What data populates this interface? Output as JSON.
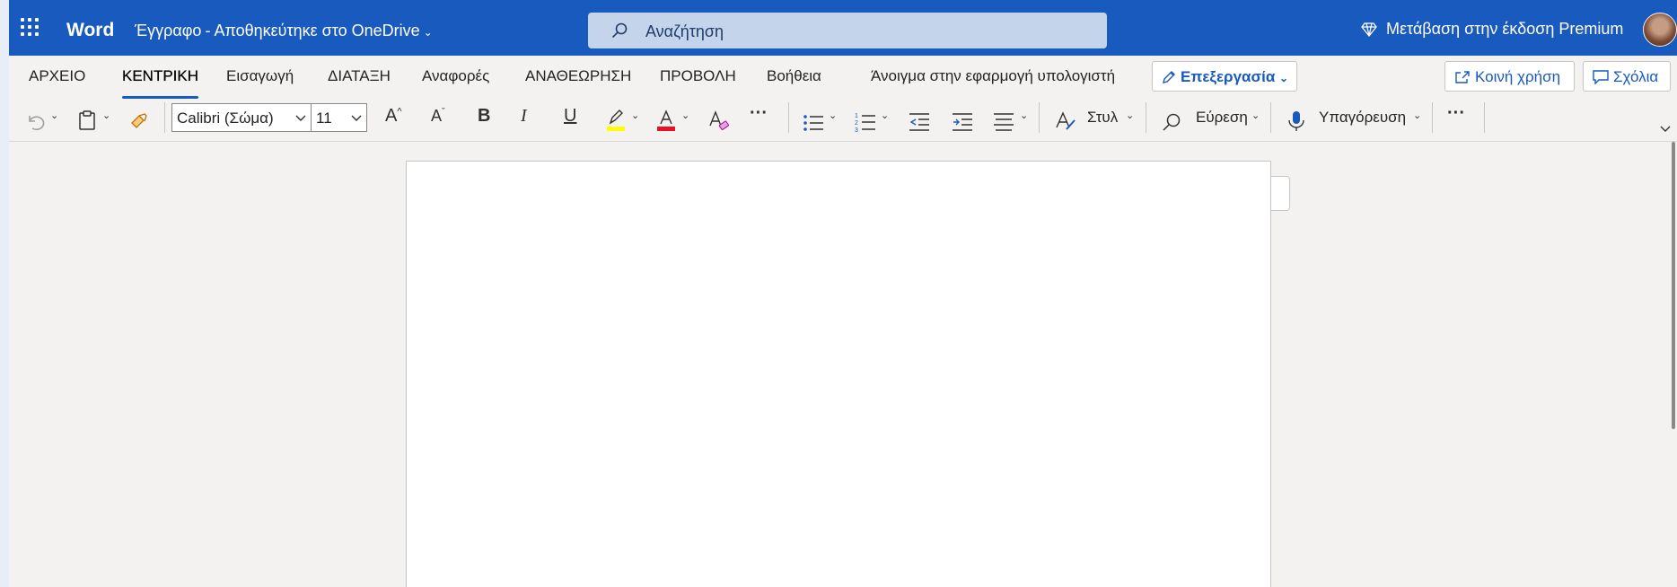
{
  "titlebar": {
    "app_name": "Word",
    "doc_name": "Έγγραφο",
    "separator": "-",
    "save_status": "Αποθηκεύτηκε στο OneDrive",
    "search_placeholder": "Αναζήτηση",
    "premium_label": "Μετάβαση στην έκδοση Premium",
    "bar_color": "#185abd"
  },
  "ribbon": {
    "tabs": [
      {
        "label": "ΑΡΧΕΙΟ"
      },
      {
        "label": "ΚΕΝΤΡΙΚΗ",
        "active": true
      },
      {
        "label": "Εισαγωγή"
      },
      {
        "label": "ΔΙΑΤΑΞΗ"
      },
      {
        "label": "Αναφορές"
      },
      {
        "label": "ΑΝΑΘΕΩΡΗΣΗ"
      },
      {
        "label": "ΠΡΟΒΟΛΗ"
      },
      {
        "label": "Βοήθεια"
      },
      {
        "label": "Άνοιγμα στην εφαρμογή υπολογιστή"
      }
    ],
    "edit_mode_label": "Επεξεργασία",
    "share_label": "Κοινή χρήση",
    "comments_label": "Σχόλια",
    "font_name": "Calibri (Σώμα)",
    "font_size": "11",
    "styles_label": "Στυλ",
    "find_label": "Εύρεση",
    "dictate_label": "Υπαγόρευση",
    "bold_glyph": "B",
    "italic_glyph": "I",
    "underline_glyph": "U",
    "more_glyph": "···",
    "highlight_color": "#ffff00",
    "font_color": "#e81123"
  }
}
